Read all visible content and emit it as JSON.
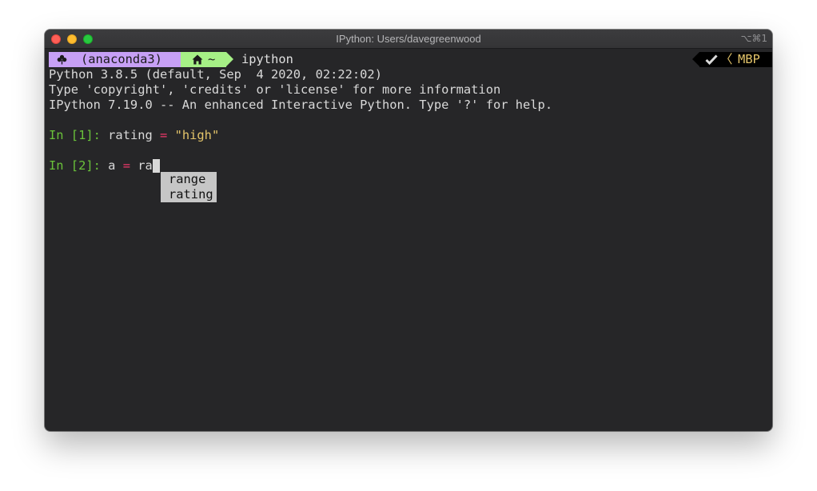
{
  "window": {
    "title": "IPython: Users/davegreenwood",
    "shortcut": "⌥⌘1"
  },
  "prompt": {
    "env": "(anaconda3)",
    "dir": "~",
    "command": "ipython",
    "right_host": "MBP",
    "right_sep": "〈"
  },
  "banner": [
    "Python 3.8.5 (default, Sep  4 2020, 02:22:02)",
    "Type 'copyright', 'credits' or 'license' for more information",
    "IPython 7.19.0 -- An enhanced Interactive Python. Type '?' for help."
  ],
  "cells": [
    {
      "prompt": "In [1]:",
      "var": "rating",
      "op": "=",
      "value": "\"high\""
    },
    {
      "prompt": "In [2]:",
      "var": "a",
      "op": "=",
      "value": "ra"
    }
  ],
  "completions": [
    "range",
    "rating"
  ],
  "colors": {
    "env_segment": "#c7a0f5",
    "home_segment": "#a6f086",
    "prompt_green": "#6ac23a",
    "operator_pink": "#f0386a",
    "string_yellow": "#e3c46a"
  }
}
